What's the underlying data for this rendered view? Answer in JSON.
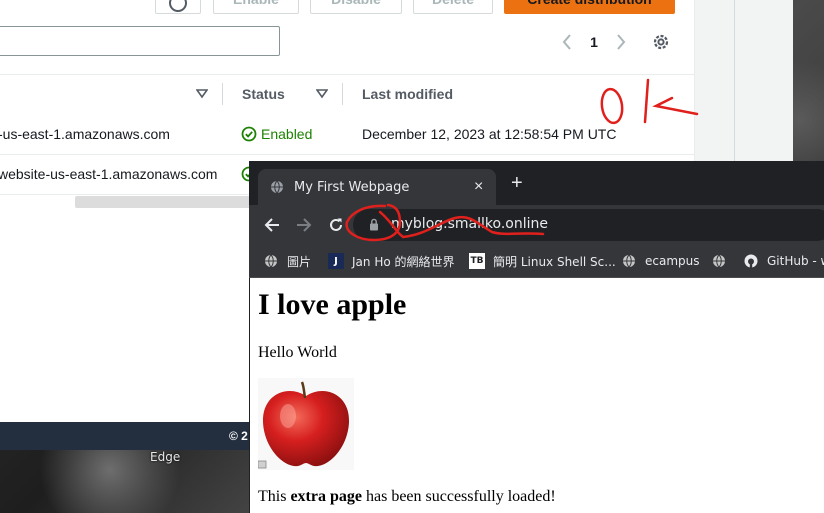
{
  "aws": {
    "toolbar": {
      "enable_label": "Enable",
      "disable_label": "Disable",
      "delete_label": "Delete",
      "create_label": "Create distribution"
    },
    "pagination": {
      "current_page": "1"
    },
    "table": {
      "headers": {
        "status": "Status",
        "last_modified": "Last modified"
      },
      "rows": [
        {
          "domain": "-us-east-1.amazonaws.com",
          "status": "Enabled",
          "last_modified": "December 12, 2023 at 12:58:54 PM UTC"
        },
        {
          "domain": "website-us-east-1.amazonaws.com",
          "status": "",
          "last_modified": ""
        }
      ]
    },
    "footer": {
      "text": "© 2"
    }
  },
  "desktop": {
    "edge_label": "Edge"
  },
  "annotation": {
    "text": "OK",
    "color": "#e0201c"
  },
  "chrome": {
    "tab": {
      "title": "My First Webpage",
      "close": "×",
      "new_tab": "+"
    },
    "address_bar": {
      "url": "myblog.smallko.online"
    },
    "bookmarks": [
      {
        "icon": "globe-icon",
        "label": "圖片"
      },
      {
        "icon": "J",
        "label": "Jan Ho 的網絡世界"
      },
      {
        "icon": "TB",
        "label": "簡明 Linux Shell Sc..."
      },
      {
        "icon": "globe-icon",
        "label": "ecampus"
      },
      {
        "icon": "globe-icon",
        "label": ""
      },
      {
        "icon": "github-icon",
        "label": "GitHub - w"
      }
    ]
  },
  "webpage": {
    "heading": "I love apple",
    "paragraph": "Hello World",
    "footer_pre": "This ",
    "footer_bold": "extra page",
    "footer_post": " has been successfully loaded!"
  },
  "colors": {
    "aws_orange": "#ec7211",
    "enabled_green": "#1d8102",
    "aws_footer": "#232f3e",
    "chrome_dark": "#202124",
    "chrome_toolbar": "#35363a"
  }
}
